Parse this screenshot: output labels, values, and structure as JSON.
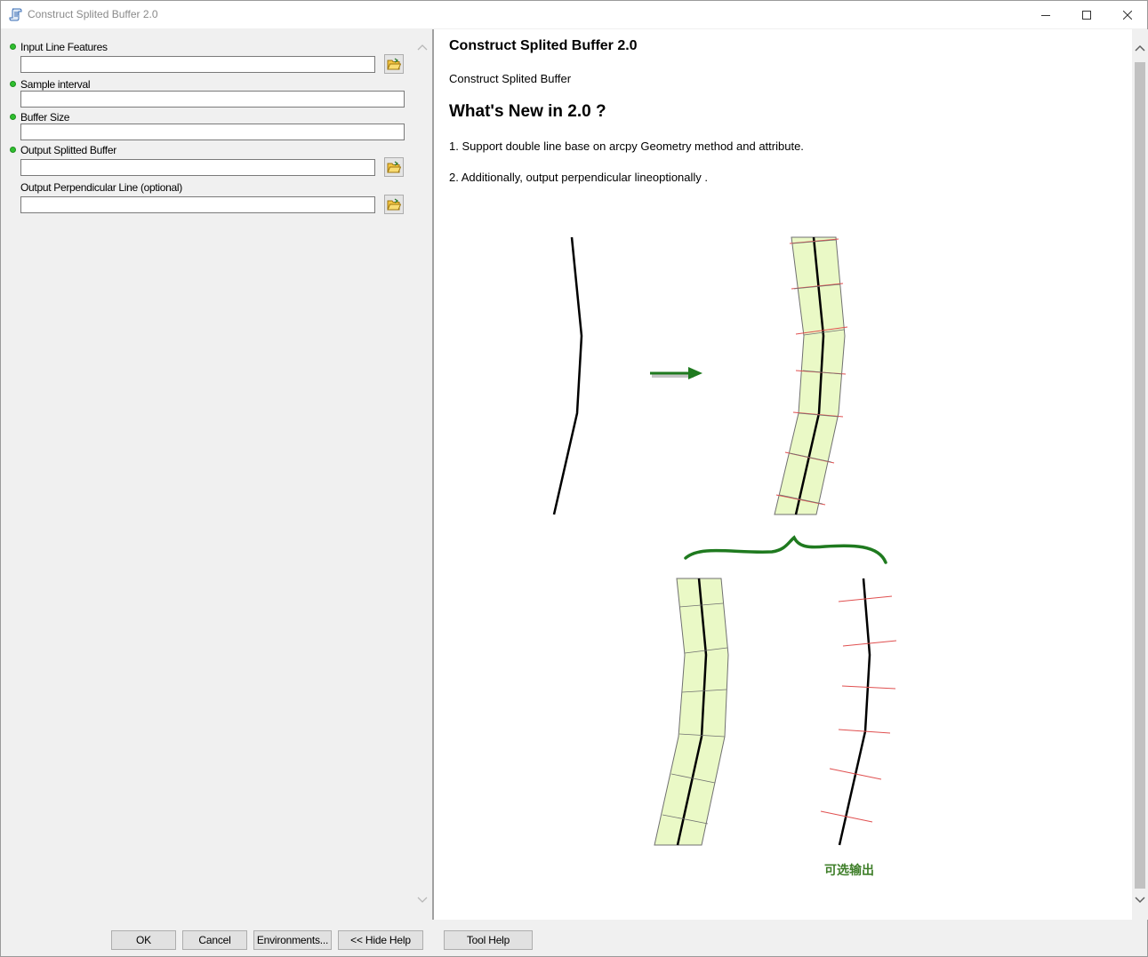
{
  "window": {
    "title": "Construct Splited Buffer 2.0"
  },
  "params": [
    {
      "label": "Input Line Features",
      "required": true,
      "value": "",
      "browse": true
    },
    {
      "label": "Sample interval",
      "required": true,
      "value": "",
      "browse": false
    },
    {
      "label": "Buffer Size",
      "required": true,
      "value": "",
      "browse": false
    },
    {
      "label": "Output Splitted Buffer",
      "required": true,
      "value": "",
      "browse": true
    },
    {
      "label": "Output Perpendicular Line (optional)",
      "required": false,
      "value": "",
      "browse": true
    }
  ],
  "buttons": {
    "ok": "OK",
    "cancel": "Cancel",
    "environments": "Environments...",
    "hide_help": "<< Hide Help",
    "tool_help": "Tool Help"
  },
  "help": {
    "title": "Construct Splited Buffer 2.0",
    "subtitle": "Construct Splited Buffer",
    "heading": "What's New in 2.0 ?",
    "items": [
      "1. Support double line base on arcpy Geometry method and attribute.",
      "2. Additionally, output perpendicular lineoptionally ."
    ],
    "optional_output_label": "可选输出"
  },
  "colors": {
    "required_dot": "#2fbf2f",
    "arrow_green": "#1f7a1f",
    "buffer_fill": "#eaf9c6",
    "perp_red": "#e05050",
    "caption_green": "#3f7f2a"
  }
}
